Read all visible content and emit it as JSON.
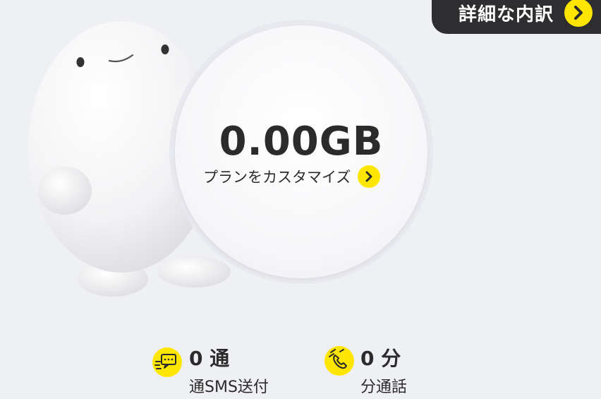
{
  "detail_button": {
    "label": "詳細な内訳",
    "icon": "chevron-right-icon"
  },
  "data_usage": {
    "value": "0.00GB",
    "customize_label": "プランをカスタマイズ"
  },
  "stats": {
    "sms": {
      "value": "0 通",
      "label": "通SMS送付",
      "icon": "sms-icon"
    },
    "call": {
      "value": "0 分",
      "label": "分通話",
      "icon": "phone-call-icon"
    }
  },
  "colors": {
    "accent": "#ffe600",
    "dark": "#2e2e30",
    "background": "#eff0f4"
  }
}
